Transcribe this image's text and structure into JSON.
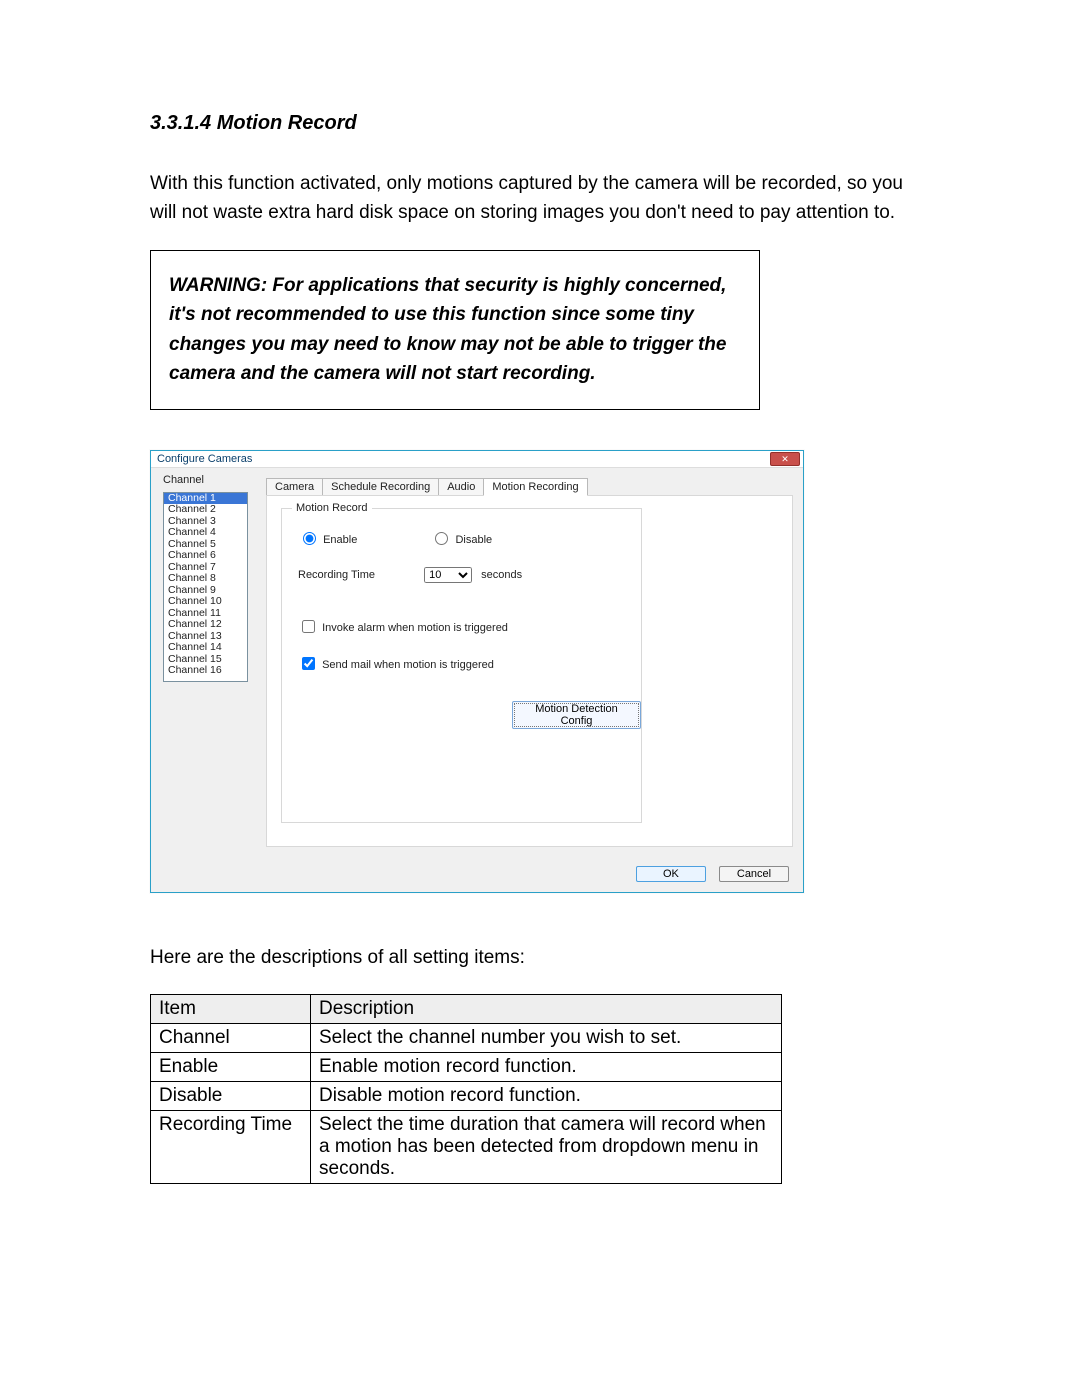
{
  "heading": "3.3.1.4 Motion Record",
  "intro": "With this function activated, only motions captured by the camera will be recorded, so you will not waste extra hard disk space on storing images you don't need to pay attention to.",
  "warning": "WARNING: For applications that security is highly concerned, it's not recommended to use this function since some tiny changes you may need to know may not be able to trigger the camera and the camera will not start recording.",
  "dialog": {
    "title": "Configure Cameras",
    "close_glyph": "✕",
    "channel_label": "Channel",
    "channels": [
      "Channel 1",
      "Channel 2",
      "Channel 3",
      "Channel 4",
      "Channel 5",
      "Channel 6",
      "Channel 7",
      "Channel 8",
      "Channel 9",
      "Channel 10",
      "Channel 11",
      "Channel 12",
      "Channel 13",
      "Channel 14",
      "Channel 15",
      "Channel 16"
    ],
    "selected_channel_index": 0,
    "tabs": [
      "Camera",
      "Schedule Recording",
      "Audio",
      "Motion Recording"
    ],
    "active_tab_index": 3,
    "group_title": "Motion Record",
    "radio_enable": "Enable",
    "radio_disable": "Disable",
    "radio_selected": "enable",
    "recording_time_label": "Recording Time",
    "recording_time_value": "10",
    "seconds_label": "seconds",
    "chk_invoke_label": "Invoke alarm when motion is triggered",
    "chk_invoke_checked": false,
    "chk_mail_label": "Send mail when motion is triggered",
    "chk_mail_checked": true,
    "motion_config_btn": "Motion Detection Config",
    "ok_btn": "OK",
    "cancel_btn": "Cancel"
  },
  "desc_intro": "Here are the descriptions of all setting items:",
  "table": {
    "h1": "Item",
    "h2": "Description",
    "rows": [
      {
        "item": "Channel",
        "desc": "Select the channel number you wish to set."
      },
      {
        "item": "Enable",
        "desc": "Enable motion record function."
      },
      {
        "item": "Disable",
        "desc": "Disable motion record function."
      },
      {
        "item": "Recording Time",
        "desc": "Select the time duration that camera will record when a motion has been detected from dropdown menu in seconds."
      }
    ]
  }
}
